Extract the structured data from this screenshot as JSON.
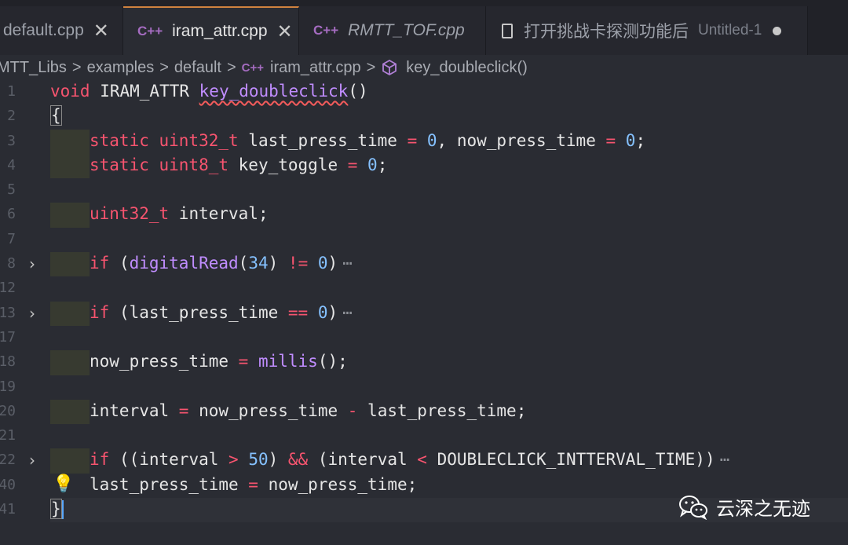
{
  "tabs": [
    {
      "title": "default.cpp",
      "close": "✕",
      "state": "inactive"
    },
    {
      "title": "iram_attr.cpp",
      "icon": "C++",
      "close": "✕",
      "state": "active"
    },
    {
      "title": "RMTT_TOF.cpp",
      "icon": "C++",
      "state": "inactive-italic"
    },
    {
      "title": "打开挑战卡探测功能后",
      "description": "Untitled-1",
      "state": "unsaved"
    }
  ],
  "breadcrumb": {
    "items": [
      "MTT_Libs",
      "examples",
      "default",
      "iram_attr.cpp",
      "key_doubleclick()"
    ],
    "lang_icon": "C++",
    "separator": ">"
  },
  "code_lines": [
    {
      "ln": "1"
    },
    {
      "ln": "2"
    },
    {
      "ln": "3"
    },
    {
      "ln": "4"
    },
    {
      "ln": "5"
    },
    {
      "ln": "6"
    },
    {
      "ln": "7"
    },
    {
      "ln": "8"
    },
    {
      "ln": "12"
    },
    {
      "ln": "13"
    },
    {
      "ln": "17"
    },
    {
      "ln": "18"
    },
    {
      "ln": "19"
    },
    {
      "ln": "20"
    },
    {
      "ln": "21"
    },
    {
      "ln": "22"
    },
    {
      "ln": "40"
    },
    {
      "ln": "41"
    }
  ],
  "code": {
    "l1": {
      "kw": "void",
      "type": " IRAM_ATTR ",
      "fn": "key_doubleclick",
      "rest": "()"
    },
    "l2": {
      "text": "{"
    },
    "l3": {
      "kw1": "static",
      "ty": " uint32_t",
      "a": " last_press_time ",
      "op": "=",
      "n1": " 0",
      "b": ", now_press_time ",
      "op2": "=",
      "n2": " 0",
      "end": ";"
    },
    "l4": {
      "kw1": "static",
      "ty": " uint8_t",
      "a": " key_toggle ",
      "op": "=",
      "n1": " 0",
      "end": ";"
    },
    "l6": {
      "ty": "uint32_t",
      "a": " interval;"
    },
    "l8": {
      "kw": "if",
      "a": " (",
      "fn": "digitalRead",
      "b": "(",
      "n1": "34",
      "c": ") ",
      "op": "!=",
      "n2": " 0",
      "d": ")",
      "fold": "⋯"
    },
    "l13": {
      "kw": "if",
      "a": " (last_press_time ",
      "op": "==",
      "n1": " 0",
      "d": ")",
      "fold": "⋯"
    },
    "l18": {
      "a": "now_press_time ",
      "op": "=",
      "fn": " millis",
      "d": "();"
    },
    "l20": {
      "a": "interval ",
      "op": "=",
      "b": " now_press_time ",
      "op2": "-",
      "c": " last_press_time;"
    },
    "l22": {
      "kw": "if",
      "a": " ((interval ",
      "op": ">",
      "n1": " 50",
      "b": ") ",
      "op2": "&&",
      "c": " (interval ",
      "op3": "<",
      "d": " DOUBLECLICK_INTTERVAL_TIME))",
      "fold": "⋯"
    },
    "l40": {
      "a": "last_press_time ",
      "op": "=",
      "b": " now_press_time;"
    },
    "l41": {
      "text": "}"
    }
  },
  "gutter": {
    "fold_chevron": "›",
    "lightbulb_icon": "💡"
  },
  "watermark": {
    "text": "云深之无迹",
    "icon": "wechat-icon"
  },
  "colors": {
    "keyword": "#f7546f",
    "number": "#85c1ff",
    "function": "#c08dff",
    "tab_accent": "#d0823f"
  }
}
